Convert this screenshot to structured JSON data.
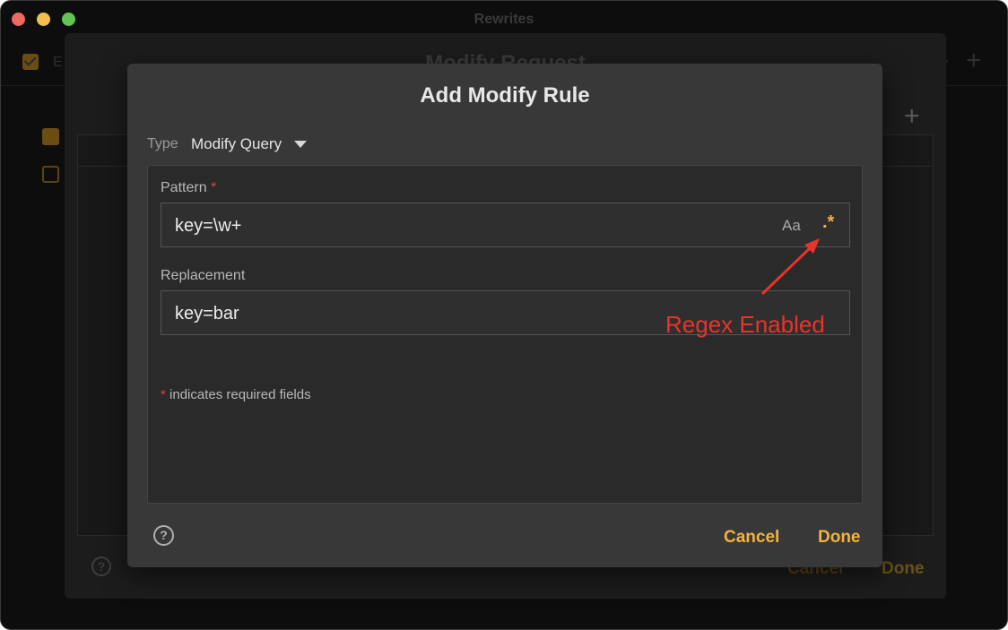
{
  "window": {
    "title": "Rewrites",
    "enable_label": "E"
  },
  "modify_request": {
    "title": "Modify Request",
    "cancel_label": "Cancel",
    "done_label": "Done",
    "help_glyph": "?"
  },
  "dialog": {
    "title": "Add Modify Rule",
    "type_label": "Type",
    "type_value": "Modify Query",
    "pattern_label": "Pattern",
    "pattern_value": "key=\\w+",
    "case_toggle": "Aa",
    "regex_toggle": ".*",
    "replacement_label": "Replacement",
    "replacement_value": "key=bar",
    "required_star": "*",
    "required_note": "indicates required fields",
    "help_glyph": "?",
    "cancel_label": "Cancel",
    "done_label": "Done"
  },
  "annotation": {
    "text": "Regex Enabled",
    "color": "#e5352a"
  },
  "colors": {
    "accent": "#f2b33d",
    "required": "#e0433a",
    "dialog_bg": "#383838"
  },
  "icons": [
    "chevron-down-icon",
    "help-icon",
    "plus-icon",
    "checkbox-icon",
    "arrow-icon"
  ]
}
